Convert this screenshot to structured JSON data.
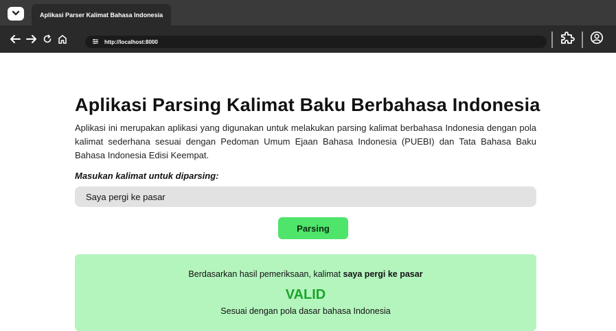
{
  "browser": {
    "tab_title": "Aplikasi Parser Kalimat Bahasa Indonesia",
    "url": "http://localhost:8000",
    "icons": [
      "chevron-down-icon",
      "back-arrow-icon",
      "forward-arrow-icon",
      "reload-icon",
      "home-icon",
      "site-settings-icon",
      "extensions-puzzle-icon",
      "account-icon"
    ]
  },
  "page": {
    "title": "Aplikasi Parsing Kalimat Baku Berbahasa Indonesia",
    "description": "Aplikasi ini merupakan aplikasi yang digunakan untuk melakukan parsing kalimat berbahasa Indonesia dengan pola kalimat sederhana sesuai dengan Pedoman Umum Ejaan Bahasa Indonesia (PUEBI) dan Tata Bahasa Baku Bahasa Indonesia Edisi Keempat.",
    "input_label": "Masukan kalimat untuk diparsing:",
    "input_value": "Saya pergi ke pasar",
    "button_label": "Parsing"
  },
  "result": {
    "prefix": "Berdasarkan hasil pemeriksaan, kalimat ",
    "sentence": "saya pergi ke pasar",
    "status": "VALID",
    "note": "Sesuai dengan pola dasar bahasa Indonesia"
  },
  "colors": {
    "browser_dark": "#2a2a2a",
    "button_green": "#4fe46a",
    "result_bg": "#b4f5be",
    "valid_green": "#1aa52a"
  }
}
